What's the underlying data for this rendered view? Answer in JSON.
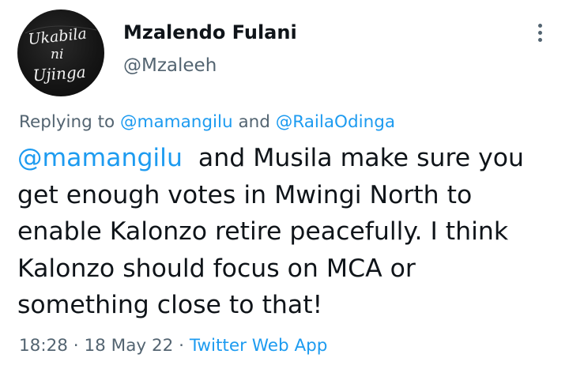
{
  "author": {
    "display_name": "Mzalendo Fulani",
    "handle": "@Mzaleeh",
    "avatar_text": [
      "Ukabila",
      "ni",
      "Ujinga"
    ],
    "avatar_icon": "avatar-icon"
  },
  "header": {
    "more_icon": "more-vertical-icon"
  },
  "replying": {
    "prefix": "Replying to ",
    "user1": "@mamangilu",
    "conjunction": " and ",
    "user2": "@RailaOdinga"
  },
  "tweet": {
    "mention": "@mamangilu",
    "text": "  and Musila make sure you get enough votes in Mwingi North to enable Kalonzo retire peacefully. I think Kalonzo should focus on MCA or something close to that!"
  },
  "meta": {
    "time": "18:28",
    "separator1": " · ",
    "date": "18 May 22",
    "separator2": " · ",
    "source": "Twitter Web App"
  },
  "colors": {
    "link": "#1d9bf0",
    "secondary_text": "#536471",
    "primary_text": "#0f1419"
  }
}
